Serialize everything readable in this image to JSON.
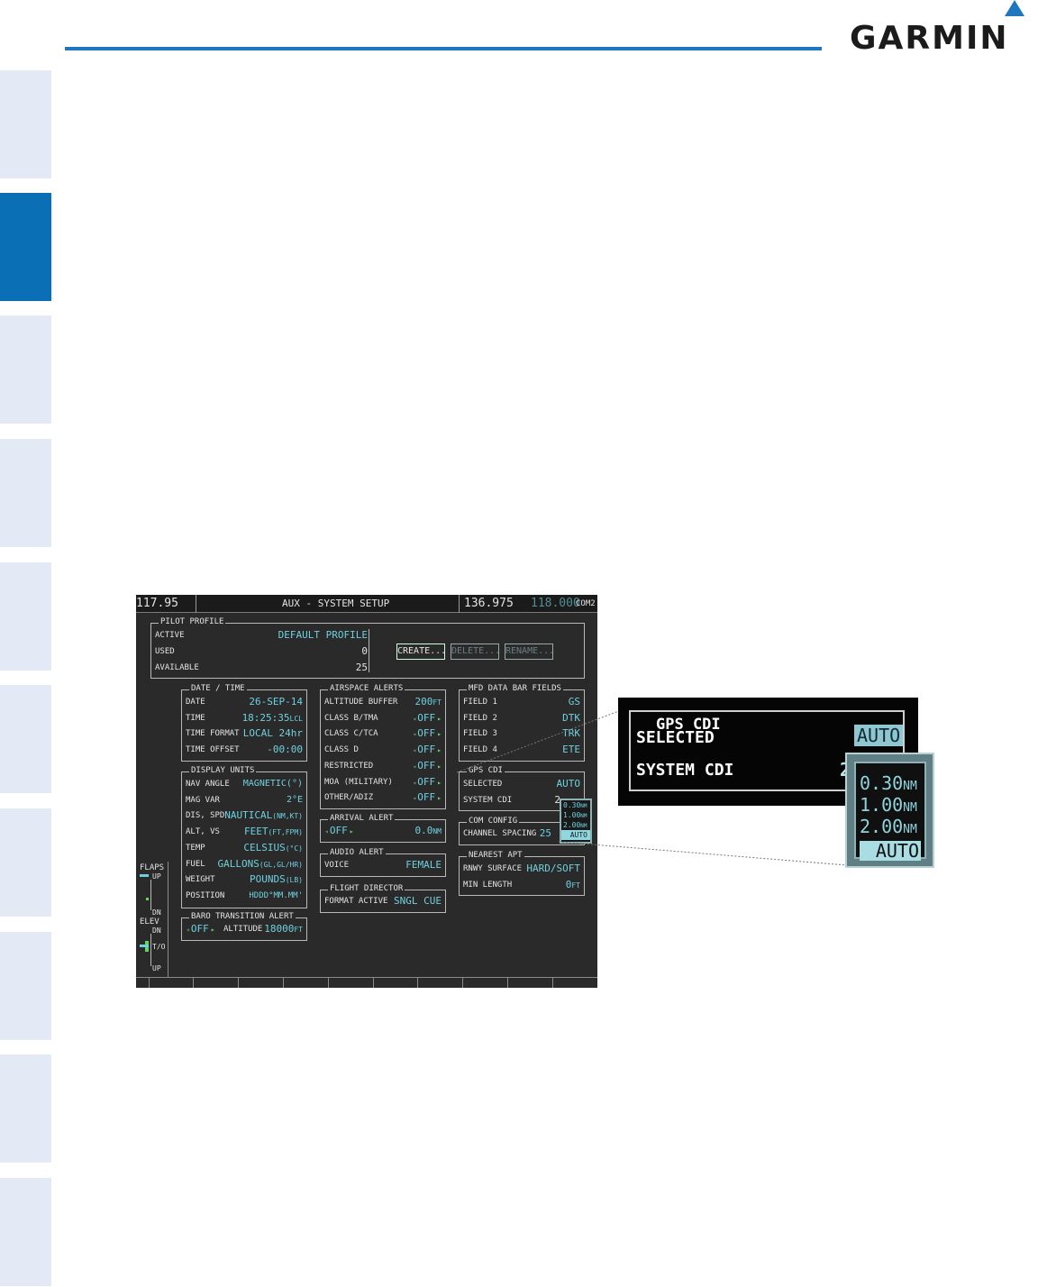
{
  "brand": {
    "logo_text": "GARMIN",
    "accent_color": "#1f76c0",
    "side_tab_active_color": "#0a6fb5"
  },
  "screen": {
    "top_bar": {
      "nav_freq": "117.95",
      "page_title": "AUX - SYSTEM SETUP",
      "com_active": "136.975",
      "com_standby": "118.000",
      "com_label": "COM2"
    },
    "pilot_profile": {
      "title": "PILOT PROFILE",
      "active_label": "ACTIVE",
      "active_value": "DEFAULT PROFILE",
      "used_label": "USED",
      "used_value": "0",
      "available_label": "AVAILABLE",
      "available_value": "25",
      "create_button": "CREATE...",
      "delete_button": "DELETE...",
      "rename_button": "RENAME..."
    },
    "date_time": {
      "title": "DATE / TIME",
      "date_label": "DATE",
      "date_value": "26-SEP-14",
      "time_label": "TIME",
      "time_value": "18:25:35",
      "time_unit": "LCL",
      "format_label": "TIME FORMAT",
      "format_value": "LOCAL 24hr",
      "offset_label": "TIME OFFSET",
      "offset_value": "-00:00"
    },
    "display_units": {
      "title": "DISPLAY UNITS",
      "nav_angle_label": "NAV ANGLE",
      "nav_angle_value": "MAGNETIC(°)",
      "mag_var_label": "MAG VAR",
      "mag_var_value": "2°E",
      "dis_spd_label": "DIS, SPD",
      "dis_spd_value": "NAUTICAL",
      "dis_spd_unit": "(NM,KT)",
      "alt_vs_label": "ALT, VS",
      "alt_vs_value": "FEET",
      "alt_vs_unit": "(FT,FPM)",
      "temp_label": "TEMP",
      "temp_value": "CELSIUS",
      "temp_unit": "(°C)",
      "fuel_label": "FUEL",
      "fuel_value": "GALLONS",
      "fuel_unit": "(GL,GL/HR)",
      "weight_label": "WEIGHT",
      "weight_value": "POUNDS",
      "weight_unit": "(LB)",
      "position_label": "POSITION",
      "position_value": "HDDD°MM.MM'"
    },
    "baro_alert": {
      "title": "BARO TRANSITION ALERT",
      "state": "OFF",
      "altitude_label": "ALTITUDE",
      "altitude_value": "18000",
      "altitude_unit": "FT"
    },
    "airspace_alerts": {
      "title": "AIRSPACE ALERTS",
      "buffer_label": "ALTITUDE BUFFER",
      "buffer_value": "200",
      "buffer_unit": "FT",
      "class_b_label": "CLASS B/TMA",
      "class_b_value": "OFF",
      "class_c_label": "CLASS C/TCA",
      "class_c_value": "OFF",
      "class_d_label": "CLASS D",
      "class_d_value": "OFF",
      "restricted_label": "RESTRICTED",
      "restricted_value": "OFF",
      "moa_label": "MOA (MILITARY)",
      "moa_value": "OFF",
      "other_label": "OTHER/ADIZ",
      "other_value": "OFF"
    },
    "arrival_alert": {
      "title": "ARRIVAL ALERT",
      "state": "OFF",
      "distance": "0.0",
      "distance_unit": "NM"
    },
    "audio_alert": {
      "title": "AUDIO ALERT",
      "voice_label": "VOICE",
      "voice_value": "FEMALE"
    },
    "flight_director": {
      "title": "FLIGHT DIRECTOR",
      "format_label": "FORMAT ACTIVE",
      "format_value": "SNGL CUE"
    },
    "mfd_fields": {
      "title": "MFD DATA BAR FIELDS",
      "f1_label": "FIELD 1",
      "f1_value": "GS",
      "f2_label": "FIELD 2",
      "f2_value": "DTK",
      "f3_label": "FIELD 3",
      "f3_value": "TRK",
      "f4_label": "FIELD 4",
      "f4_value": "ETE"
    },
    "gps_cdi": {
      "title": "GPS CDI",
      "selected_label": "SELECTED",
      "selected_value": "AUTO",
      "system_label": "SYSTEM CDI",
      "system_value": "2"
    },
    "com_config": {
      "title": "COM CONFIG",
      "spacing_label": "CHANNEL SPACING",
      "spacing_value": "25"
    },
    "nearest_apt": {
      "title": "NEAREST APT",
      "surface_label": "RNWY SURFACE",
      "surface_value": "HARD/SOFT",
      "length_label": "MIN LENGTH",
      "length_value": "0",
      "length_unit": "FT"
    },
    "flaps": {
      "flaps_label": "FLAPS",
      "up": "UP",
      "dn": "DN",
      "elev_label": "ELEV",
      "elev_dn": "DN",
      "to": "T/O",
      "elev_up": "UP"
    },
    "cdi_popup": {
      "opt1": "0.30",
      "opt2": "1.00",
      "opt3": "2.00",
      "unit": "NM",
      "opt4": "AUTO"
    }
  },
  "callout": {
    "title": "GPS CDI",
    "selected_label": "SELECTED",
    "selected_value": "AUTO",
    "system_label": "SYSTEM CDI",
    "system_value": "2",
    "options": [
      "0.30",
      "1.00",
      "2.00"
    ],
    "unit": "NM",
    "auto_option": "AUTO"
  }
}
